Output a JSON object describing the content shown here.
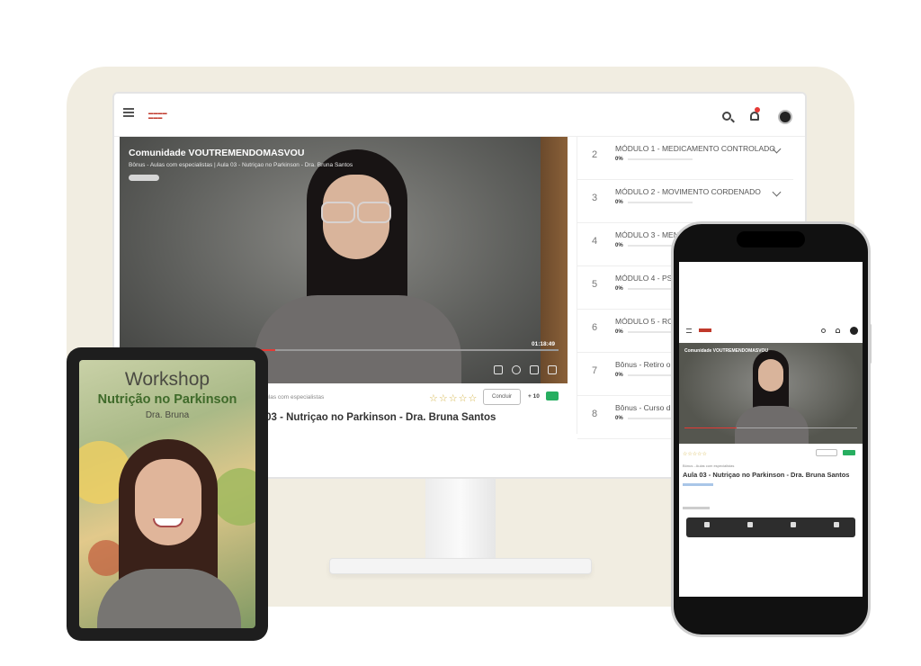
{
  "desktop": {
    "video": {
      "title": "Comunidade VOUTREMENDOMASVOU",
      "subtitle": "Bônus - Aulas com especialistas | Aula 03 - Nutriçao no Parkinson - Dra. Bruna Santos",
      "time": "01:18:49"
    },
    "lesson": {
      "crumb": "Bônus - Aulas com especialistas",
      "title": "Aula 03 - Nutriçao no Parkinson - Dra. Bruna Santos",
      "rating_stars": "☆☆☆☆☆",
      "conclude_label": "Concluir",
      "points": "+ 10"
    },
    "modules": [
      {
        "num": "2",
        "name": "MÓDULO 1 - MEDICAMENTO CONTROLADO",
        "pct": "0%"
      },
      {
        "num": "3",
        "name": "MÓDULO 2 - MOVIMENTO CORDENADO",
        "pct": "0%"
      },
      {
        "num": "4",
        "name": "MÓDULO 3 - MEN",
        "pct": "0%"
      },
      {
        "num": "5",
        "name": "MÓDULO 4 - PS",
        "pct": "0%"
      },
      {
        "num": "6",
        "name": "MÓDULO 5 - RO",
        "pct": "0%"
      },
      {
        "num": "7",
        "name": "Bônus - Retiro o",
        "pct": "0%"
      },
      {
        "num": "8",
        "name": "Bônus - Curso d",
        "pct": "0%"
      }
    ]
  },
  "tablet": {
    "title": "Workshop",
    "subtitle": "Nutrição no Parkinson",
    "name": "Dra. Bruna"
  },
  "phone": {
    "video_title": "Comunidade VOUTREMENDOMASVOU",
    "lesson_title": "Aula 03 - Nutriçao no Parkinson - Dra. Bruna Santos",
    "crumb": "Bônus - Aulas com especialistas"
  },
  "colors": {
    "backdrop": "#f1ede1",
    "accent_red": "#e53935",
    "points_green": "#27ae60",
    "tablet_green": "#3f6a2a"
  }
}
